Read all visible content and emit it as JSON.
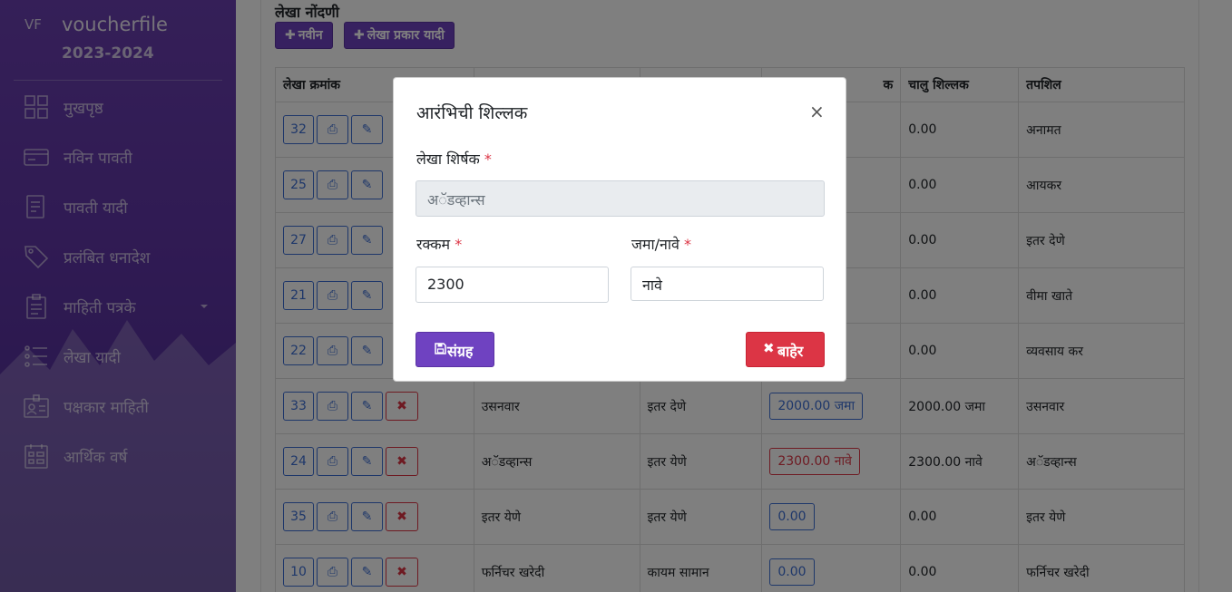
{
  "sidebar": {
    "brand_mini": "VF",
    "brand_name": "voucherfile",
    "brand_year": "2023-2024",
    "items": [
      {
        "label": "मुखपृष्ठ",
        "icon": "dashboard-grid-icon"
      },
      {
        "label": "नविन पावती",
        "icon": "card-icon"
      },
      {
        "label": "पावती यादी",
        "icon": "document-list-icon"
      },
      {
        "label": "प्रलंबित धनादेश",
        "icon": "tag-icon"
      },
      {
        "label": "माहिती पत्रके",
        "icon": "clipboard-icon",
        "has_caret": true
      },
      {
        "label": "लेखा यादी",
        "icon": "bullet-list-icon"
      },
      {
        "label": "पक्षकार माहिती",
        "icon": "contact-card-icon"
      },
      {
        "label": "आर्थिक वर्ष",
        "icon": "calendar-grid-icon"
      }
    ]
  },
  "main": {
    "title": "लेखा नोंदणी",
    "btn_new": "नवीन",
    "btn_type_list": "लेखा प्रकार यादी",
    "columns": [
      "लेखा क्रमांक",
      "",
      "",
      "क",
      "चालु शिल्लक",
      "तपशिल"
    ],
    "rows": [
      {
        "num": "32",
        "delete": false,
        "name": "",
        "type": "",
        "opening": "",
        "opening_style": "",
        "current": "0.00",
        "detail": "अनामत"
      },
      {
        "num": "25",
        "delete": false,
        "name": "",
        "type": "",
        "opening": "",
        "opening_style": "",
        "current": "0.00",
        "detail": "आयकर"
      },
      {
        "num": "27",
        "delete": false,
        "name": "",
        "type": "",
        "opening": "",
        "opening_style": "",
        "current": "0.00",
        "detail": "इतर देणे"
      },
      {
        "num": "21",
        "delete": false,
        "name": "",
        "type": "",
        "opening": "",
        "opening_style": "",
        "current": "0.00",
        "detail": "वीमा खाते"
      },
      {
        "num": "22",
        "delete": false,
        "name": "",
        "type": "",
        "opening": "",
        "opening_style": "",
        "current": "0.00",
        "detail": "व्यवसाय कर"
      },
      {
        "num": "33",
        "delete": true,
        "name": "उसनवार",
        "type": "इतर देणे",
        "opening": "2000.00 जमा",
        "opening_style": "blue",
        "current": "2000.00 जमा",
        "detail": "उसनवार"
      },
      {
        "num": "24",
        "delete": true,
        "name": "अॅडव्हान्स",
        "type": "इतर येणे",
        "opening": "2300.00 नावे",
        "opening_style": "red",
        "current": "2300.00 नावे",
        "detail": "अॅडव्हान्स"
      },
      {
        "num": "35",
        "delete": true,
        "name": "इतर येणे",
        "type": "इतर येणे",
        "opening": "0.00",
        "opening_style": "blue",
        "current": "0.00",
        "detail": "इतर येणे"
      },
      {
        "num": "10",
        "delete": true,
        "name": "फर्निचर खरेदी",
        "type": "कायम सामान",
        "opening": "0.00",
        "opening_style": "blue",
        "current": "0.00",
        "detail": "फर्निचर खरेदी"
      }
    ]
  },
  "modal": {
    "title": "आरंभिची शिल्लक",
    "close": "×",
    "account_label": "लेखा शिर्षक",
    "account_value": "अॅडव्हान्स",
    "amount_label": "रक्कम",
    "amount_value": "2300",
    "crdr_label": "जमा/नावे",
    "crdr_value": "नावे",
    "required_mark": "*",
    "save_label": "संग्रह",
    "exit_label": "बाहेर"
  },
  "colors": {
    "primary": "#6f42c1",
    "danger": "#dc3545",
    "info": "#3d6ed4"
  }
}
